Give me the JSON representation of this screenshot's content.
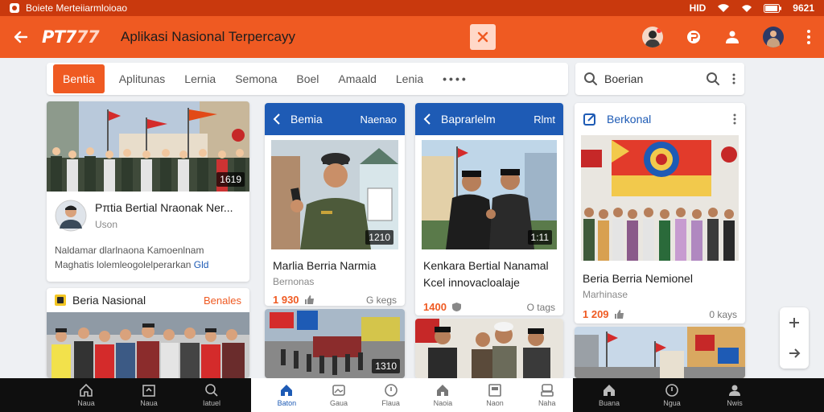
{
  "status_bar": {
    "title": "Boiete Merteiiarmloioao",
    "time": "9621",
    "battery": "HID"
  },
  "app_bar": {
    "logo_primary": "PT7",
    "logo_secondary": "77",
    "title": "Aplikasi Nasional Terpercayy"
  },
  "tabs": [
    {
      "label": "Bentia",
      "active": true
    },
    {
      "label": "Aplitunas"
    },
    {
      "label": "Lernia"
    },
    {
      "label": "Semona"
    },
    {
      "label": "Boel"
    },
    {
      "label": "Amaald"
    },
    {
      "label": "Lenia"
    },
    {
      "label": "••••"
    }
  ],
  "search": {
    "value": "Boerian",
    "placeholder": "Boerian"
  },
  "cards": {
    "profile": {
      "title": "Pπtia Bertial Nraonak Ner...",
      "byline": "Uson",
      "excerpt_line1": "Naldamar dlarlnaona Kamoenlnam",
      "excerpt_line2": "Maghatis lolemleogolelperarkan",
      "excerpt_link": "Gld",
      "photo_duration": "1619"
    },
    "nasional": {
      "title": "Beria Nasional",
      "link": "Benales"
    },
    "video1": {
      "header_title": "Bemia",
      "header_sub": "Naenao",
      "duration": "1210",
      "title": "Marlia Berria Narmia",
      "meta": "Bernonas",
      "count": "1 930",
      "tags": "G kegs",
      "thumb_duration": "1310"
    },
    "video2": {
      "header_title": "Baprarlelm",
      "header_sub": "Rlmt",
      "duration": "1:11",
      "title_line1": "Kenkara Bertial Nanamal",
      "title_line2": "Kcel innovacloalaje",
      "count": "1400",
      "tags": "O tags"
    },
    "national": {
      "header_title": "Berkonal",
      "title": "Beria Berria Nemionel",
      "meta": "Marhinase",
      "count": "1 209",
      "tags": "0 kays"
    }
  },
  "bottom_nav": {
    "left": [
      {
        "label": "Naua"
      },
      {
        "label": "Naua"
      },
      {
        "label": "Iatuel"
      }
    ],
    "middle": [
      {
        "label": "Baton",
        "active": true
      },
      {
        "label": "Gaua"
      },
      {
        "label": "Flaua"
      },
      {
        "label": "Naoia"
      },
      {
        "label": "Naon"
      },
      {
        "label": "Naha"
      }
    ],
    "right": [
      {
        "label": "Buana"
      },
      {
        "label": "Ngua"
      },
      {
        "label": "Nwis"
      }
    ]
  },
  "colors": {
    "accent": "#ef5a22",
    "blue": "#1e5bb5",
    "status": "#c9390d"
  }
}
